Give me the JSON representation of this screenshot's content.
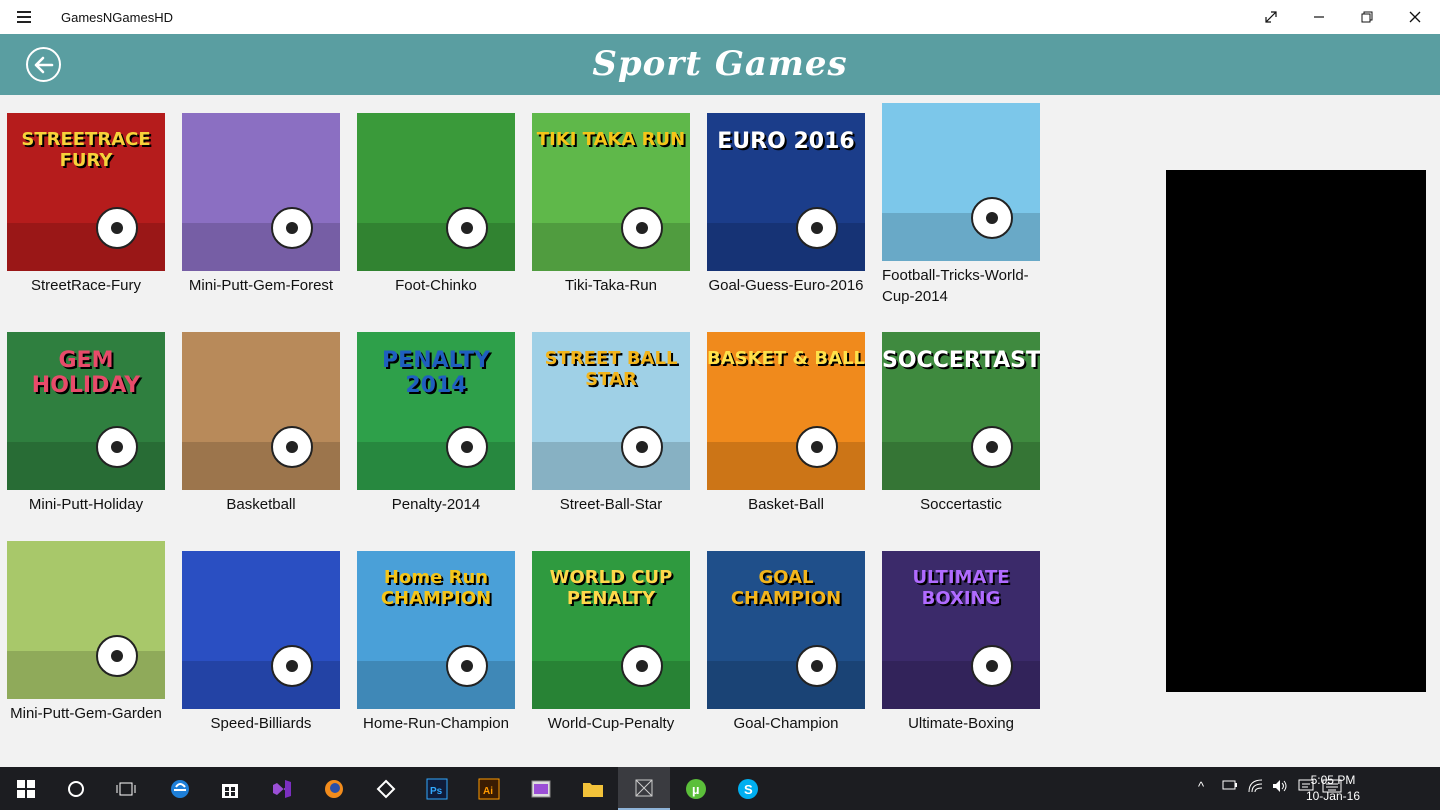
{
  "window": {
    "title": "GamesNGamesHD"
  },
  "header": {
    "title": "Sport Games"
  },
  "games": [
    {
      "label": "StreetRace-Fury",
      "art": "STREETRACE FURY",
      "bg": "#b51c1c",
      "fg": "#f7d23a"
    },
    {
      "label": "Mini-Putt-Gem-Forest",
      "art": "",
      "bg": "#8b6fc2",
      "fg": "#ffffff"
    },
    {
      "label": "Foot-Chinko",
      "art": "",
      "bg": "#3a9a3a",
      "fg": "#ffffff"
    },
    {
      "label": "Tiki-Taka-Run",
      "art": "TIKI TAKA RUN",
      "bg": "#5fb84a",
      "fg": "#f5c518"
    },
    {
      "label": "Goal-Guess-Euro-2016",
      "art": "EURO 2016",
      "bg": "#1b3d8a",
      "fg": "#ffffff"
    },
    {
      "label": "Football-Tricks-World-Cup-2014",
      "art": "",
      "bg": "#7cc7ea",
      "fg": "#ffffff"
    },
    {
      "label": "Mini-Putt-Holiday",
      "art": "GEM HOLIDAY",
      "bg": "#2f7f3f",
      "fg": "#e84b6a"
    },
    {
      "label": "Basketball",
      "art": "",
      "bg": "#b88a5a",
      "fg": "#ffffff"
    },
    {
      "label": "Penalty-2014",
      "art": "PENALTY 2014",
      "bg": "#2ea04a",
      "fg": "#1f5fbf"
    },
    {
      "label": "Street-Ball-Star",
      "art": "STREET BALL STAR",
      "bg": "#9fd0e6",
      "fg": "#f2b51c"
    },
    {
      "label": "Basket-Ball",
      "art": "BASKET & BALL",
      "bg": "#f08a1c",
      "fg": "#ffe14a"
    },
    {
      "label": "Soccertastic",
      "art": "SOCCERTASTIC",
      "bg": "#3f8a3f",
      "fg": "#ffffff"
    },
    {
      "label": "Mini-Putt-Gem-Garden",
      "art": "",
      "bg": "#a8c86a",
      "fg": "#ffffff"
    },
    {
      "label": "Speed-Billiards",
      "art": "",
      "bg": "#2a4fc2",
      "fg": "#ffffff"
    },
    {
      "label": "Home-Run-Champion",
      "art": "Home Run CHAMPION",
      "bg": "#4aa0d8",
      "fg": "#f5c518"
    },
    {
      "label": "World-Cup-Penalty",
      "art": "WORLD CUP PENALTY",
      "bg": "#2f9a3f",
      "fg": "#ffd84a"
    },
    {
      "label": "Goal-Champion",
      "art": "GOAL CHAMPION",
      "bg": "#1f4f8a",
      "fg": "#f2b51c"
    },
    {
      "label": "Ultimate-Boxing",
      "art": "ULTIMATE BOXING",
      "bg": "#3b2a6a",
      "fg": "#b06bff"
    }
  ],
  "taskbar": {
    "time": "5:05 PM",
    "date": "10-Jan-16",
    "apps": [
      "start-icon",
      "cortana-icon",
      "task-view-icon",
      "edge-icon",
      "store-icon",
      "visual-studio-icon",
      "firefox-icon",
      "unity-icon",
      "photoshop-icon",
      "illustrator-icon",
      "app-icon",
      "file-explorer-icon",
      "games-app-icon",
      "utorrent-icon",
      "skype-icon"
    ]
  },
  "colors": {
    "header": "#5a9ea1",
    "background": "#f2f2f2",
    "taskbar": "#1c1d21"
  }
}
